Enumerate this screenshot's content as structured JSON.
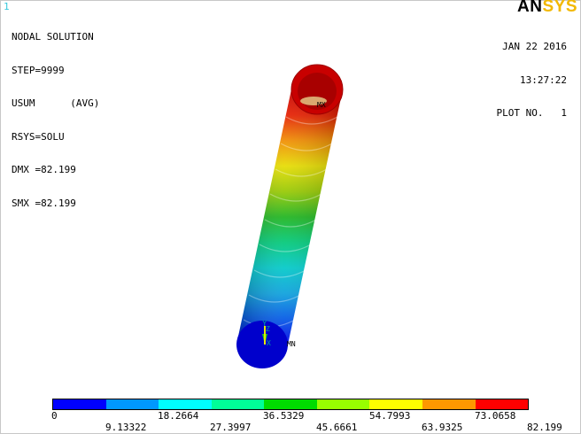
{
  "window_number": "1",
  "info_lines": [
    "NODAL SOLUTION",
    "STEP=9999",
    "USUM      (AVG)",
    "RSYS=SOLU",
    "DMX =82.199",
    "SMX =82.199"
  ],
  "logo": {
    "part1": "AN",
    "part2": "SYS"
  },
  "date": "JAN 22 2016",
  "time": "13:27:22",
  "plot_no": "PLOT NO.   1",
  "max_marker": "MX",
  "min_marker": "MN",
  "triad_y": "Y",
  "triad_z": "Z",
  "triad_x": "X",
  "legend": {
    "colors": [
      "#0000ff",
      "#0098ff",
      "#00ffff",
      "#00ff98",
      "#00dc00",
      "#98ff00",
      "#ffff00",
      "#ff9800",
      "#ff0000"
    ],
    "upper_labels": [
      "0",
      "18.2664",
      "36.5329",
      "54.7993",
      "73.0658"
    ],
    "lower_labels": [
      "9.13322",
      "27.3997",
      "45.6661",
      "63.9325",
      "82.199"
    ]
  }
}
